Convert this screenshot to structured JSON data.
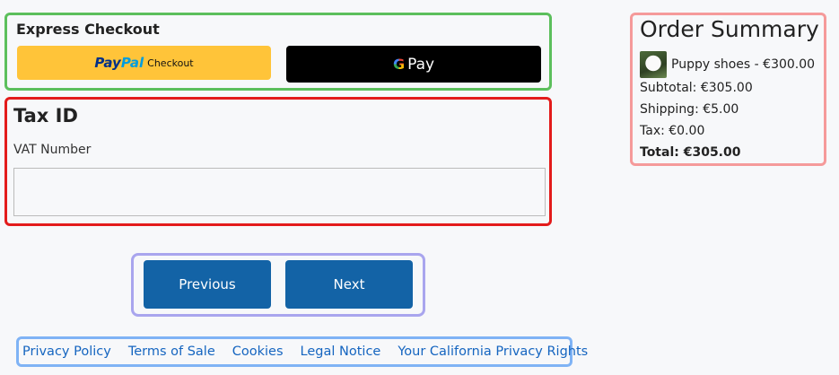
{
  "express": {
    "title": "Express Checkout",
    "paypal": {
      "pay": "Pay",
      "pal": "Pal",
      "checkout": "Checkout"
    },
    "gpay": {
      "g": "G",
      "pay": "Pay"
    }
  },
  "tax": {
    "title": "Tax ID",
    "vat_label": "VAT Number",
    "vat_value": "",
    "vat_placeholder": ""
  },
  "nav": {
    "previous": "Previous",
    "next": "Next"
  },
  "footer": {
    "links": [
      "Privacy Policy",
      "Terms of Sale",
      "Cookies",
      "Legal Notice",
      "Your California Privacy Rights"
    ]
  },
  "summary": {
    "title": "Order Summary",
    "item": "Puppy shoes - €300.00",
    "subtotal": "Subtotal: €305.00",
    "shipping": "Shipping: €5.00",
    "tax": "Tax: €0.00",
    "total": "Total: €305.00"
  },
  "colors": {
    "express_border": "#5cbf5c",
    "tax_border": "#e31b1b",
    "nav_border": "#a9a5ee",
    "footer_border": "#7fb3f5",
    "summary_border": "#f59a9a",
    "primary_button": "#1363a6",
    "paypal_yellow": "#ffc439"
  }
}
